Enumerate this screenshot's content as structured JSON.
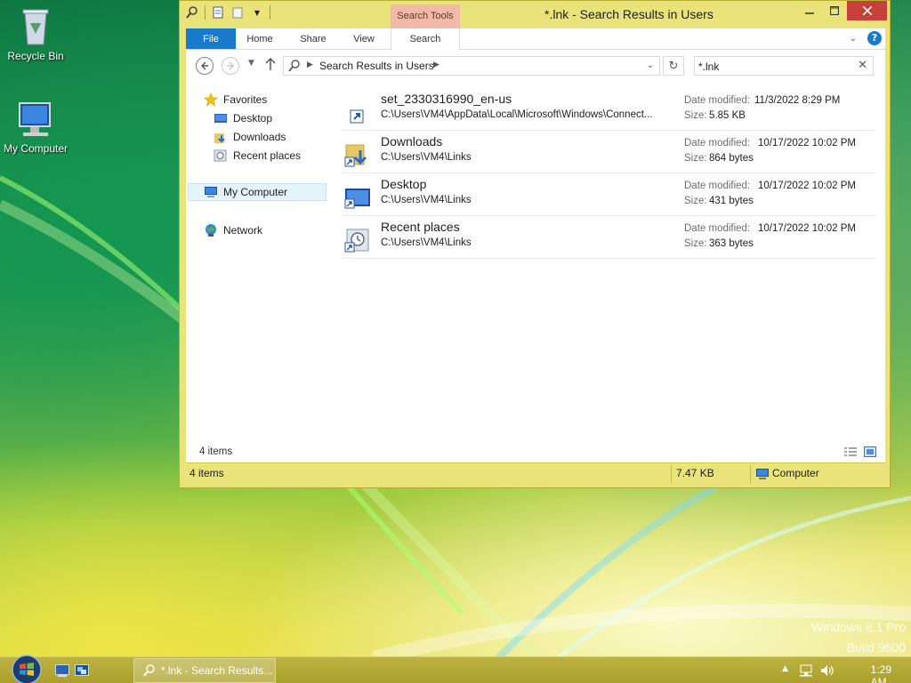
{
  "desktop": {
    "icons": [
      {
        "label": "Recycle Bin",
        "icon": "recycle-bin-icon"
      },
      {
        "label": "My Computer",
        "icon": "computer-icon"
      }
    ],
    "watermark": {
      "line1": "Windows 8.1 Pro",
      "line2": "Build 9600"
    }
  },
  "window": {
    "title": "*.lnk - Search Results in Users",
    "context_tab": "Search Tools",
    "ribbon_tabs": [
      "File",
      "Home",
      "Share",
      "View",
      "Search"
    ],
    "address": {
      "path": "Search Results in Users"
    },
    "search": {
      "value": "*.lnk"
    },
    "nav": {
      "items": [
        {
          "label": "Favorites",
          "icon": "star-icon"
        },
        {
          "label": "Desktop",
          "icon": "desktop-icon"
        },
        {
          "label": "Downloads",
          "icon": "downloads-icon"
        },
        {
          "label": "Recent places",
          "icon": "recent-places-icon"
        },
        {
          "label": "My Computer",
          "icon": "computer-icon",
          "selected": true
        },
        {
          "label": "Network",
          "icon": "network-icon"
        }
      ]
    },
    "results": [
      {
        "name": "set_2330316990_en-us",
        "path": "C:\\Users\\VM4\\AppData\\Local\\Microsoft\\Windows\\Connect...",
        "modified_label": "Date modified:",
        "modified": "11/3/2022 8:29 PM",
        "size_label": "Size:",
        "size": "5.85 KB",
        "icon": "shortcut-icon"
      },
      {
        "name": "Downloads",
        "path": "C:\\Users\\VM4\\Links",
        "modified_label": "Date modified:",
        "modified": "10/17/2022 10:02 PM",
        "size_label": "Size:",
        "size": "864 bytes",
        "icon": "downloads-shortcut-icon"
      },
      {
        "name": "Desktop",
        "path": "C:\\Users\\VM4\\Links",
        "modified_label": "Date modified:",
        "modified": "10/17/2022 10:02 PM",
        "size_label": "Size:",
        "size": "431 bytes",
        "icon": "desktop-shortcut-icon"
      },
      {
        "name": "Recent places",
        "path": "C:\\Users\\VM4\\Links",
        "modified_label": "Date modified:",
        "modified": "10/17/2022 10:02 PM",
        "size_label": "Size:",
        "size": "363 bytes",
        "icon": "recent-places-shortcut-icon"
      }
    ],
    "content_count": "4 items",
    "status": {
      "items": "4 items",
      "size": "7.47 KB",
      "location": "Computer"
    }
  },
  "taskbar": {
    "task_label": "*.lnk - Search Results...",
    "clock": "1:29 AM"
  },
  "colors": {
    "window_frame": "#e9e37a",
    "close_button": "#c7403a",
    "file_tab": "#1979ca",
    "context_tab": "#f2b9a8"
  }
}
